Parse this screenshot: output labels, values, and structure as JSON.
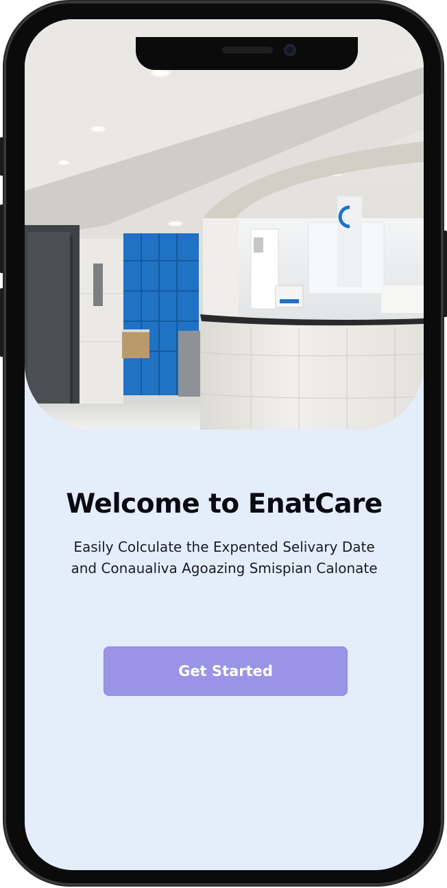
{
  "onboarding": {
    "title": "Welcome to EnatCare",
    "subtitle": "Easily Colculate the Expented Selivary Date and Conaualiva Agoazing Smispian Calonate",
    "cta_label": "Get Started"
  },
  "colors": {
    "background": "#e4eefb",
    "button": "#9a94e6",
    "title": "#0a0a12",
    "accent_wall": "#1f72c4"
  }
}
